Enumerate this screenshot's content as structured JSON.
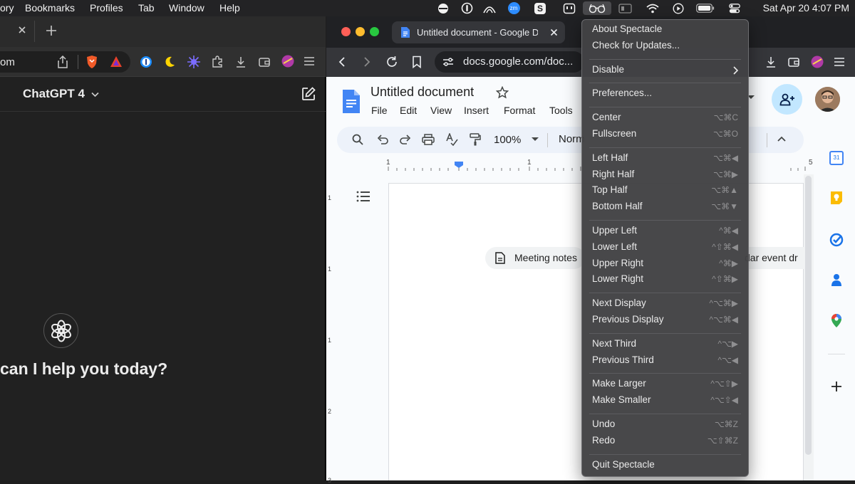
{
  "menubar": {
    "items": [
      "ory",
      "Bookmarks",
      "Profiles",
      "Tab",
      "Window",
      "Help"
    ],
    "tray_icons": [
      "contrast-icon",
      "onepassword-icon",
      "arc-icon",
      "zoom-icon",
      "s-app-icon",
      "screen-icon",
      "spectacle-icon",
      "cc-icon",
      "wifi-icon",
      "play-icon",
      "battery-icon",
      "control-center-icon"
    ],
    "zoom_label": "zm",
    "s_label": "S",
    "clock": "Sat Apr 20  4:07 PM"
  },
  "left_window": {
    "url": "om",
    "chat_title": "ChatGPT 4",
    "prompt": "can I help you today?"
  },
  "right_window": {
    "tab_title": "Untitled document - Google Do",
    "url": "docs.google.com/doc...",
    "doc_title": "Untitled document",
    "menu": [
      "File",
      "Edit",
      "View",
      "Insert",
      "Format",
      "Tools"
    ],
    "zoom": "100%",
    "style": "Norm",
    "ruler_labels": [
      "1",
      "1",
      "1",
      "5"
    ],
    "vruler_labels": [
      "1",
      "1",
      "1",
      "2",
      "3"
    ],
    "chips": [
      "Meeting notes",
      "dar event dr"
    ],
    "calendar_label": "31"
  },
  "spectacle_menu": {
    "groups": [
      [
        {
          "label": "About Spectacle",
          "shortcut": ""
        },
        {
          "label": "Check for Updates...",
          "shortcut": ""
        }
      ],
      [
        {
          "label": "Disable",
          "shortcut": ""
        }
      ],
      [
        {
          "label": "Preferences...",
          "shortcut": ""
        }
      ],
      [
        {
          "label": "Center",
          "shortcut": "⌥⌘C"
        },
        {
          "label": "Fullscreen",
          "shortcut": "⌥⌘O"
        }
      ],
      [
        {
          "label": "Left Half",
          "shortcut": "⌥⌘◀"
        },
        {
          "label": "Right Half",
          "shortcut": "⌥⌘▶"
        },
        {
          "label": "Top Half",
          "shortcut": "⌥⌘▲"
        },
        {
          "label": "Bottom Half",
          "shortcut": "⌥⌘▼"
        }
      ],
      [
        {
          "label": "Upper Left",
          "shortcut": "^⌘◀"
        },
        {
          "label": "Lower Left",
          "shortcut": "^⇧⌘◀"
        },
        {
          "label": "Upper Right",
          "shortcut": "^⌘▶"
        },
        {
          "label": "Lower Right",
          "shortcut": "^⇧⌘▶"
        }
      ],
      [
        {
          "label": "Next Display",
          "shortcut": "^⌥⌘▶"
        },
        {
          "label": "Previous Display",
          "shortcut": "^⌥⌘◀"
        }
      ],
      [
        {
          "label": "Next Third",
          "shortcut": "^⌥▶"
        },
        {
          "label": "Previous Third",
          "shortcut": "^⌥◀"
        }
      ],
      [
        {
          "label": "Make Larger",
          "shortcut": "^⌥⇧▶"
        },
        {
          "label": "Make Smaller",
          "shortcut": "^⌥⇧◀"
        }
      ],
      [
        {
          "label": "Undo",
          "shortcut": "⌥⌘Z"
        },
        {
          "label": "Redo",
          "shortcut": "⌥⇧⌘Z"
        }
      ],
      [
        {
          "label": "Quit Spectacle",
          "shortcut": ""
        }
      ]
    ]
  },
  "colors": {
    "docs_blue": "#4285f4",
    "menu_bg": "#424244",
    "share_bg": "#c2e7ff"
  }
}
